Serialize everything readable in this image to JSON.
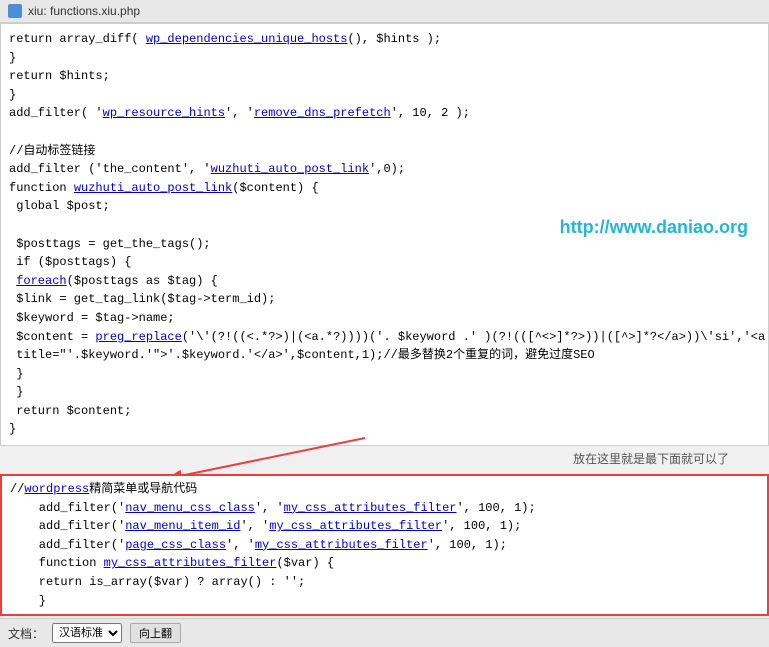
{
  "titleBar": {
    "label": "xiu: functions.xiu.php"
  },
  "codeLines": [
    "return array_diff( wp_dependencies_unique_hosts(), $hints );",
    "}",
    "return $hints;",
    "}",
    "add_filter( 'wp_resource_hints', 'remove_dns_prefetch', 10, 2 );",
    "",
    "//自动标签链接",
    "add_filter ('the_content', 'wuzhuti_auto_post_link',0);",
    "function wuzhuti_auto_post_link($content) {",
    " global $post;",
    "",
    " $posttags = get_the_tags();",
    " if ($posttags) {",
    " foreach($posttags as $tag) {",
    " $link = get_tag_link($tag->term_id);",
    " $keyword = $tag->name;",
    " $content = preg_replace('\\'(?!((<.*?)|((<a.*?))))('. $keyword .' )(?!(([^<>]*?>))|([^>]*?</a>))\\'si','<a h",
    " title=\"'.$keyword.'\">'.$keyword.'</a>',$content,1);//最多替换2个重复的词，避免过度SEO",
    " }",
    " }",
    " return $content;",
    "}"
  ],
  "annotationText": "放在这里就是最下面就可以了",
  "highlightedLines": [
    "//wordpress精简菜单或导航代码",
    "    add_filter('nav_menu_css_class', 'my_css_attributes_filter', 100, 1);",
    "    add_filter('nav_menu_item_id', 'my_css_attributes_filter', 100, 1);",
    "    add_filter('page_css_class', 'my_css_attributes_filter', 100, 1);",
    "    function my_css_attributes_filter($var) {",
    "    return is_array($var) ? array() : '';",
    "    }"
  ],
  "watermark": "http://www.daniao.org",
  "bottomBar": {
    "label": "文档：",
    "selectOptions": [
      "汉语标准"
    ],
    "buttonLabel": "向上翻"
  }
}
